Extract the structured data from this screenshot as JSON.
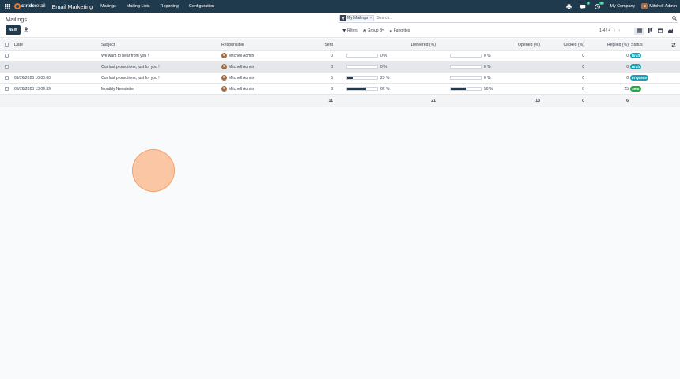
{
  "nav": {
    "brand_bold": "stride",
    "brand_rest": "retail",
    "app_title": "Email Marketing",
    "menu": [
      {
        "label": "Mailings"
      },
      {
        "label": "Mailing Lists"
      },
      {
        "label": "Reporting"
      },
      {
        "label": "Configuration"
      }
    ],
    "messages_badge": "1",
    "activities_badge": "44",
    "company": "My Company",
    "user": "Mitchell Admin"
  },
  "control_panel": {
    "breadcrumb": "Mailings",
    "new_label": "NEW",
    "search_facet": "My Mailings",
    "search_facet_remove": "×",
    "search_placeholder": "Search...",
    "filters_label": "Filters",
    "group_by_label": "Group By",
    "favorites_label": "Favorites",
    "pager": "1-4 / 4",
    "pager_prev": "‹",
    "pager_next": "›"
  },
  "table": {
    "columns": {
      "date": "Date",
      "subject": "Subject",
      "responsible": "Responsible",
      "sent": "Sent",
      "delivered": "Delivered (%)",
      "opened": "Opened (%)",
      "clicked": "Clicked (%)",
      "replied": "Replied (%)",
      "status": "Status"
    },
    "rows": [
      {
        "date": "",
        "subject": "We want to hear from you !",
        "responsible": "Mitchell Admin",
        "sent": "0",
        "delivered": 0,
        "delivered_label": "0 %",
        "opened": 0,
        "opened_label": "0 %",
        "clicked": "0",
        "replied": "0",
        "status": "Draft",
        "status_color": "#17a2b8"
      },
      {
        "date": "",
        "subject": "Our last promotions, just for you !",
        "responsible": "Mitchell Admin",
        "sent": "0",
        "delivered": 0,
        "delivered_label": "0 %",
        "opened": 0,
        "opened_label": "0 %",
        "clicked": "0",
        "replied": "0",
        "status": "Draft",
        "status_color": "#17a2b8"
      },
      {
        "date": "09/26/2023 10:00:00",
        "subject": "Our last promotions, just for you !",
        "responsible": "Mitchell Admin",
        "sent": "5",
        "delivered": 20,
        "delivered_label": "20 %",
        "opened": 0,
        "opened_label": "0 %",
        "clicked": "0",
        "replied": "0",
        "status": "In Queue",
        "status_color": "#17a2b8"
      },
      {
        "date": "03/28/2023 13:09:39",
        "subject": "Monthly Newsletter",
        "responsible": "Mitchell Admin",
        "sent": "8",
        "delivered": 62,
        "delivered_label": "62 %",
        "opened": 50,
        "opened_label": "50 %",
        "clicked": "0",
        "replied": "25",
        "status": "Sent",
        "status_color": "#28a745"
      }
    ],
    "totals": {
      "sent": "11",
      "delivered": "21",
      "opened": "13",
      "clicked": "0",
      "replied": "6"
    }
  },
  "colors": {
    "navbar": "#1f3a4d",
    "primary": "#1f3a4d",
    "click_indicator": "#fbb182"
  },
  "icons": [
    "apps-grid-icon",
    "printer-icon",
    "chat-icon",
    "clock-icon",
    "download-icon",
    "filter-icon",
    "layers-icon",
    "star-icon",
    "search-icon",
    "list-view-icon",
    "kanban-view-icon",
    "calendar-view-icon",
    "graph-view-icon",
    "column-settings-icon"
  ]
}
